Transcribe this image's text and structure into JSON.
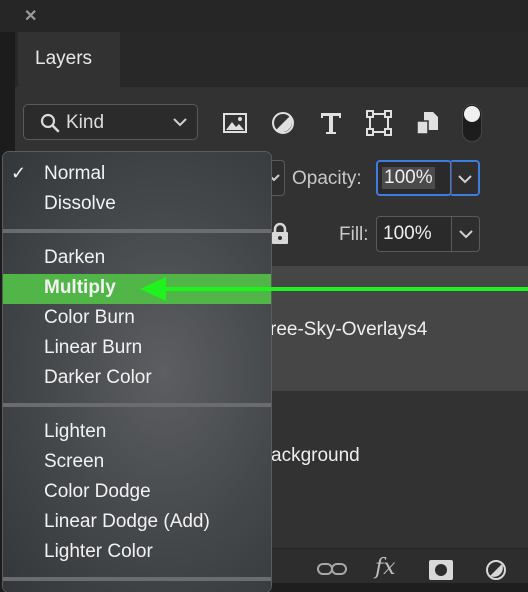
{
  "window": {
    "close_glyph": "✕"
  },
  "tabs": {
    "layers_label": "Layers"
  },
  "toolbar": {
    "kind_label": "Kind",
    "icons": [
      "image-filter-icon",
      "adjustment-filter-icon",
      "type-filter-icon",
      "shape-filter-icon",
      "smart-object-filter-icon",
      "filter-toggle"
    ]
  },
  "opacity": {
    "label": "Opacity:",
    "value": "100%"
  },
  "fill": {
    "label": "Fill:",
    "value": "100%"
  },
  "layers": [
    {
      "name": "ree-Sky-Overlays4"
    },
    {
      "name": "ackground"
    }
  ],
  "blend_menu": {
    "checked": "Normal",
    "selected": "Multiply",
    "groups": [
      [
        "Normal",
        "Dissolve"
      ],
      [
        "Darken",
        "Multiply",
        "Color Burn",
        "Linear Burn",
        "Darker Color"
      ],
      [
        "Lighten",
        "Screen",
        "Color Dodge",
        "Linear Dodge (Add)",
        "Lighter Color"
      ]
    ]
  },
  "bottom_bar": {
    "fx_label": "fx"
  },
  "colors": {
    "accent_green": "#1ff21f",
    "selection_green": "#52b548",
    "focus_blue": "#3d7de0"
  }
}
